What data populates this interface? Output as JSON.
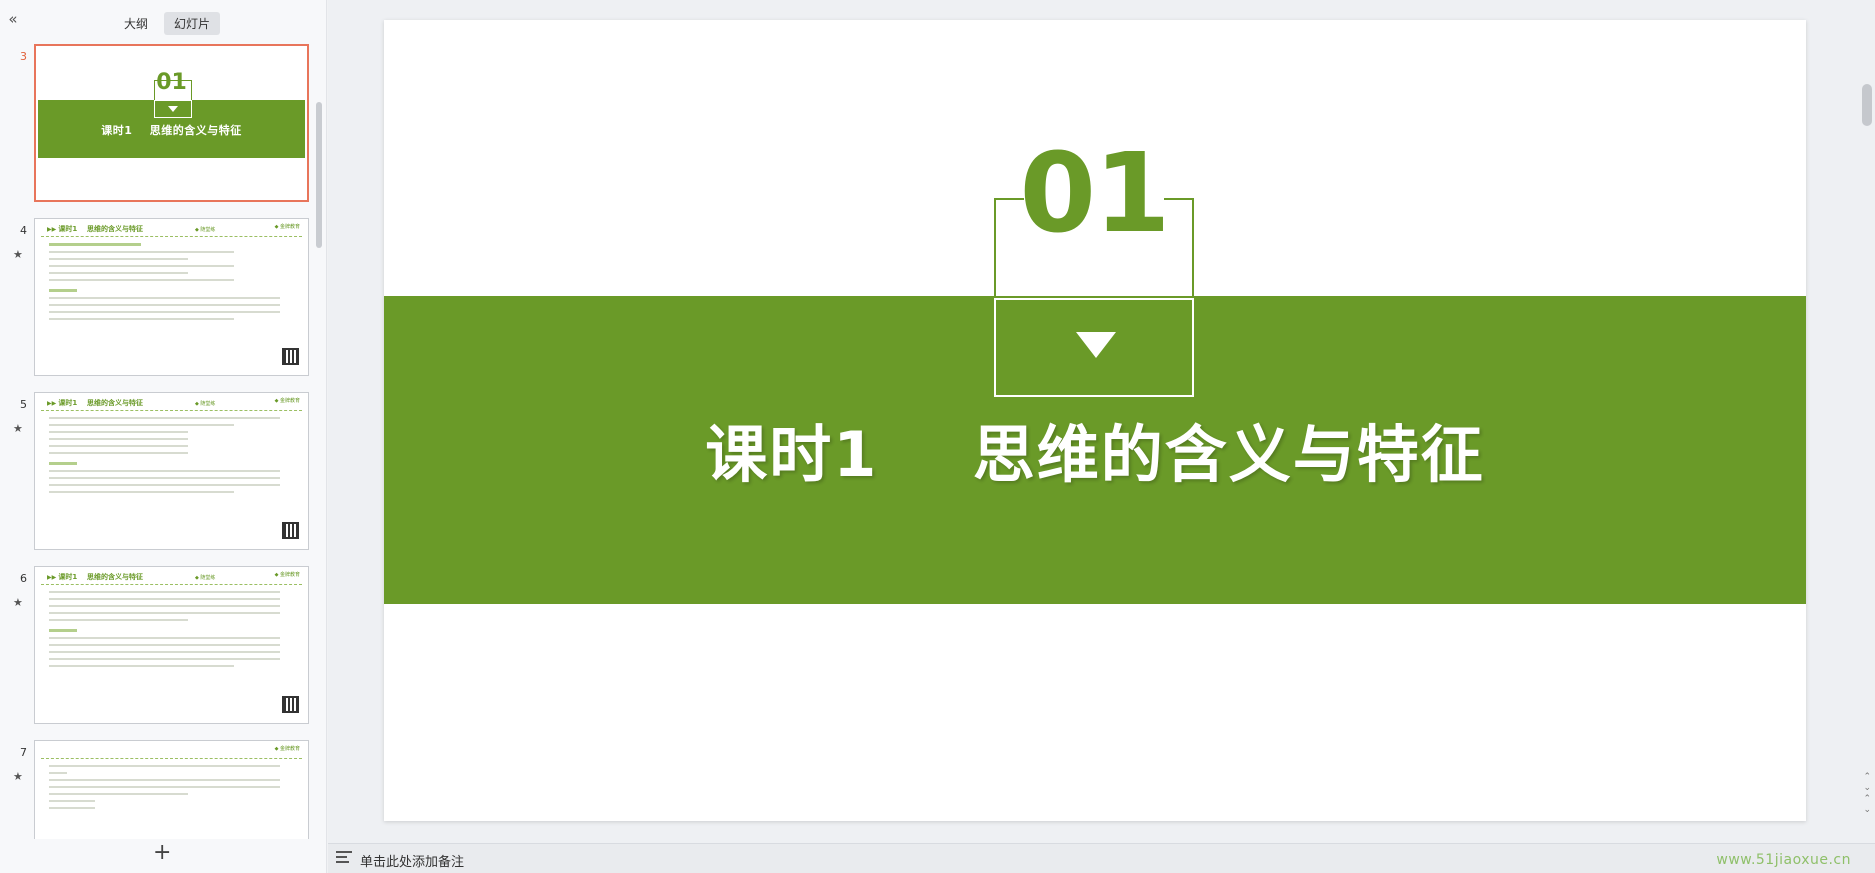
{
  "sidebar": {
    "collapse_icon": "double-chevron-left-icon",
    "collapse_glyph": "«",
    "tabs": [
      {
        "label": "大纲",
        "active": false
      },
      {
        "label": "幻灯片",
        "active": true
      }
    ],
    "thumbnails": [
      {
        "number": "3",
        "selected": true,
        "type": "title",
        "slide_num": "01",
        "title": "课时1    思维的含义与特征"
      },
      {
        "number": "4",
        "star": "★",
        "type": "content",
        "header": "课时1    思维的含义与特征",
        "tag": "◆ 随堂练",
        "logo": "◆ 金牌教育"
      },
      {
        "number": "5",
        "star": "★",
        "type": "content",
        "header": "课时1    思维的含义与特征",
        "tag": "◆ 随堂练",
        "logo": "◆ 金牌教育"
      },
      {
        "number": "6",
        "star": "★",
        "type": "content",
        "header": "课时1    思维的含义与特征",
        "tag": "◆ 随堂练",
        "logo": "◆ 金牌教育"
      },
      {
        "number": "7",
        "star": "★",
        "type": "content",
        "header": "",
        "tag": "",
        "logo": "◆ 金牌教育"
      }
    ],
    "add_slide_glyph": "+"
  },
  "slide": {
    "number_text": "01",
    "title": "课时1    思维的含义与特征",
    "accent_color": "#6a9a28"
  },
  "notes": {
    "placeholder": "单击此处添加备注",
    "icon": "notes-list-icon"
  },
  "watermark": "www.51jiaoxue.cn",
  "scroll_arrows": [
    "⌃",
    "⌄",
    "⌃",
    "⌄"
  ]
}
